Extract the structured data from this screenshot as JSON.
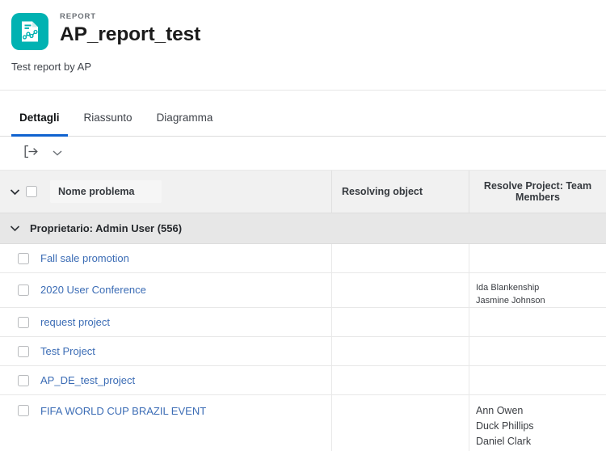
{
  "header": {
    "icon_name": "report-document-chart-icon",
    "icon_color": "#00b2b2",
    "eyebrow": "REPORT",
    "title": "AP_report_test",
    "subtitle": "Test report by AP"
  },
  "tabs": {
    "items": [
      {
        "label": "Dettagli",
        "active": true
      },
      {
        "label": "Riassunto",
        "active": false
      },
      {
        "label": "Diagramma",
        "active": false
      }
    ],
    "active_underline_color": "#0f62cf"
  },
  "toolbar": {
    "export_icon": "export-icon",
    "dropdown_icon": "chevron-down-icon"
  },
  "table": {
    "columns": [
      {
        "label": "Nome problema",
        "align": "left"
      },
      {
        "label": "Resolving object",
        "align": "left"
      },
      {
        "label": "Resolve Project: Team Members",
        "align": "center"
      }
    ],
    "group": {
      "label": "Proprietario: Admin User (556)",
      "expanded": true
    },
    "rows": [
      {
        "name": "Fall sale promotion",
        "resolving_object": "",
        "team_members": []
      },
      {
        "name": "2020 User Conference",
        "resolving_object": "",
        "team_members": [
          "Ida Blankenship",
          "Jasmine Johnson"
        ]
      },
      {
        "name": "request project",
        "resolving_object": "",
        "team_members": []
      },
      {
        "name": "Test Project",
        "resolving_object": "",
        "team_members": []
      },
      {
        "name": "AP_DE_test_project",
        "resolving_object": "",
        "team_members": []
      },
      {
        "name": "FIFA WORLD CUP BRAZIL EVENT",
        "resolving_object": "",
        "team_members": [
          "Ann Owen",
          "Duck Phillips",
          "Daniel Clark"
        ]
      }
    ],
    "link_color": "#3b6cb5"
  }
}
